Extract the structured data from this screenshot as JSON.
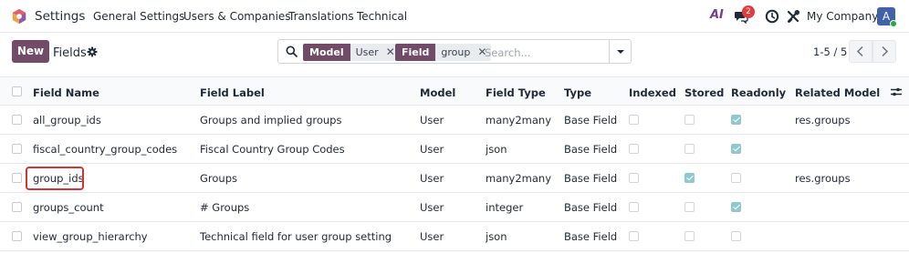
{
  "navbar": {
    "app_title": "Settings",
    "menu": [
      "General Settings",
      "Users & Companies",
      "Translations",
      "Technical"
    ],
    "ai_label": "AI",
    "messages_badge": "2",
    "company": "My Company",
    "avatar_letter": "A",
    "icons": [
      "app-logo-icon",
      "chat-icon",
      "clock-icon",
      "tools-icon"
    ]
  },
  "control_panel": {
    "new_label": "New",
    "title": "Fields",
    "search": {
      "facets": [
        {
          "label": "Model",
          "value": "User"
        },
        {
          "label": "Field",
          "value": "group"
        }
      ],
      "placeholder": "Search..."
    },
    "pager": "1-5 / 5"
  },
  "table": {
    "columns": [
      "Field Name",
      "Field Label",
      "Model",
      "Field Type",
      "Type",
      "Indexed",
      "Stored",
      "Readonly",
      "Related Model"
    ],
    "rows": [
      {
        "field_name": "all_group_ids",
        "field_label": "Groups and implied groups",
        "model": "User",
        "field_type": "many2many",
        "type": "Base Field",
        "indexed": false,
        "stored": false,
        "readonly": true,
        "related_model": "res.groups"
      },
      {
        "field_name": "fiscal_country_group_codes",
        "field_label": "Fiscal Country Group Codes",
        "model": "User",
        "field_type": "json",
        "type": "Base Field",
        "indexed": false,
        "stored": false,
        "readonly": true,
        "related_model": ""
      },
      {
        "field_name": "group_ids",
        "field_label": "Groups",
        "model": "User",
        "field_type": "many2many",
        "type": "Base Field",
        "indexed": false,
        "stored": true,
        "readonly": false,
        "related_model": "res.groups"
      },
      {
        "field_name": "groups_count",
        "field_label": "# Groups",
        "model": "User",
        "field_type": "integer",
        "type": "Base Field",
        "indexed": false,
        "stored": false,
        "readonly": true,
        "related_model": ""
      },
      {
        "field_name": "view_group_hierarchy",
        "field_label": "Technical field for user group setting",
        "model": "User",
        "field_type": "json",
        "type": "Base Field",
        "indexed": false,
        "stored": false,
        "readonly": false,
        "related_model": ""
      }
    ]
  },
  "colors": {
    "brand": "#714b67",
    "checkbox_checked": "#8fc8cf",
    "highlight": "#d9332f",
    "badge": "#e0393e"
  }
}
